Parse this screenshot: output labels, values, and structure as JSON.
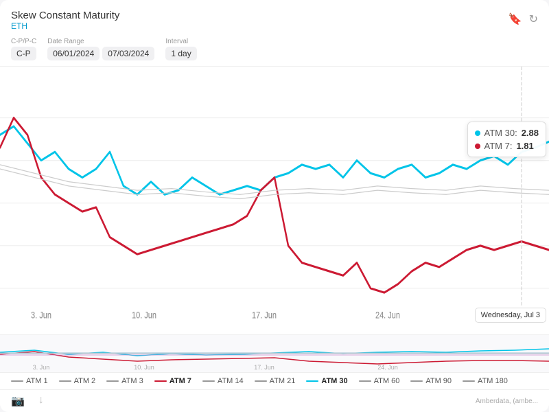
{
  "header": {
    "title": "Skew Constant Maturity",
    "subtitle": "ETH",
    "bookmark_icon": "🔖",
    "refresh_icon": "↻"
  },
  "controls": {
    "cp_label": "C-P/P-C",
    "cp_value": "C-P",
    "date_range_label": "Date Range",
    "date_start": "06/01/2024",
    "date_end": "07/03/2024",
    "interval_label": "Interval",
    "interval_value": "1 day"
  },
  "tooltip": {
    "atm30_label": "ATM 30:",
    "atm30_value": "2.88",
    "atm7_label": "ATM 7:",
    "atm7_value": "1.81",
    "date": "Wednesday, Jul 3"
  },
  "x_axis_labels": [
    {
      "text": "3. Jun",
      "x": 0.08
    },
    {
      "text": "10. Jun",
      "x": 0.27
    },
    {
      "text": "17. Jun",
      "x": 0.5
    },
    {
      "text": "24. Jun",
      "x": 0.73
    }
  ],
  "legend": [
    {
      "id": "atm1",
      "label": "ATM 1",
      "color": "#999",
      "bold": false
    },
    {
      "id": "atm2",
      "label": "ATM 2",
      "color": "#999",
      "bold": false
    },
    {
      "id": "atm3",
      "label": "ATM 3",
      "color": "#999",
      "bold": false
    },
    {
      "id": "atm7",
      "label": "ATM 7",
      "color": "#cc1a33",
      "bold": true
    },
    {
      "id": "atm14",
      "label": "ATM 14",
      "color": "#999",
      "bold": false
    },
    {
      "id": "atm21",
      "label": "ATM 21",
      "color": "#999",
      "bold": false
    },
    {
      "id": "atm30",
      "label": "ATM 30",
      "color": "#00c4e8",
      "bold": true
    },
    {
      "id": "atm60",
      "label": "ATM 60",
      "color": "#999",
      "bold": false
    },
    {
      "id": "atm90",
      "label": "ATM 90",
      "color": "#999",
      "bold": false
    },
    {
      "id": "atm180",
      "label": "ATM 180",
      "color": "#999",
      "bold": false
    }
  ],
  "watermark": "amberdata",
  "footer": {
    "attribution": "Amberdata, (ambe...",
    "camera_icon": "📷",
    "download_icon": "⬇"
  }
}
